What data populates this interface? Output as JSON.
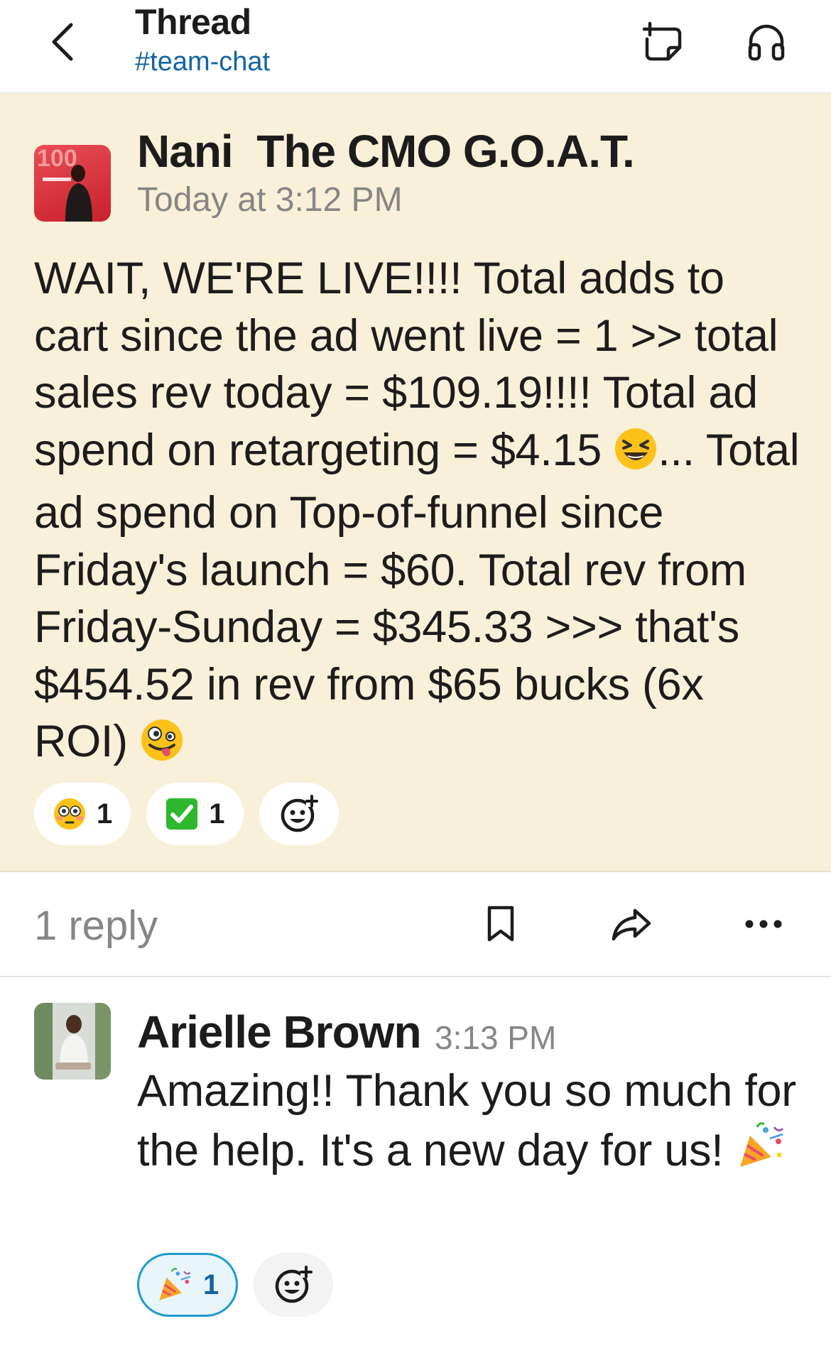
{
  "header": {
    "title": "Thread",
    "channel": "#team-chat",
    "icons": [
      "chevron-left-icon",
      "canvas-add-icon",
      "headphones-icon"
    ]
  },
  "parent_message": {
    "author": "Nani  The CMO G.O.A.T.",
    "timestamp": "Today at 3:12 PM",
    "text_part1": "WAIT, WE'RE LIVE!!!! Total adds to cart since the ad went live = 1 >> total sales rev today = $109.19!!!! Total ad spend on retargeting = $4.15 ",
    "text_part2": "... Total ad spend on Top-of-funnel since Friday's launch = $60. Total rev from Friday-Sunday = $345.33 >>> that's $454.52 in rev from $65 bucks (6x ROI) ",
    "inline_emojis": [
      "laughing-face",
      "zany-face"
    ],
    "reactions": [
      {
        "emoji": "flushed-face",
        "count": "1"
      },
      {
        "emoji": "white-check-mark",
        "count": "1"
      }
    ]
  },
  "reply_bar": {
    "reply_count": "1 reply",
    "icons": [
      "bookmark-icon",
      "share-icon",
      "more-icon"
    ]
  },
  "reply_message": {
    "author": "Arielle Brown",
    "time": "3:13 PM",
    "text": "Amazing!! Thank you so much for the help. It's a new day for us! ",
    "inline_emojis": [
      "party-popper"
    ],
    "reactions": [
      {
        "emoji": "party-popper",
        "count": "1",
        "selected": true
      }
    ]
  },
  "colors": {
    "highlight_bg": "#f8f0d8",
    "link_blue": "#1264a3",
    "selected_reaction_border": "#1d9bd1",
    "check_green": "#2eb82e"
  }
}
